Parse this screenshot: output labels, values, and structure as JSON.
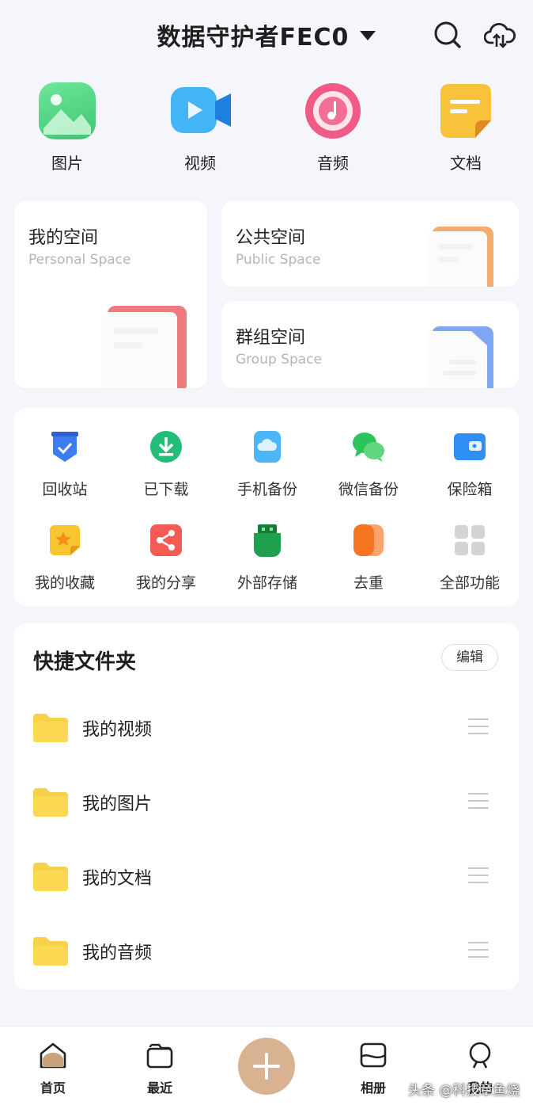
{
  "header": {
    "title": "数据守护者FEC0",
    "icons": [
      "search-icon",
      "cloud-transfer-icon"
    ]
  },
  "categories": [
    {
      "label": "图片",
      "icon": "image-icon",
      "color": "#4cd17a"
    },
    {
      "label": "视频",
      "icon": "video-icon",
      "color": "#3aa7f0"
    },
    {
      "label": "音频",
      "icon": "audio-icon",
      "color": "#f05f86"
    },
    {
      "label": "文档",
      "icon": "document-icon",
      "color": "#f7b526"
    }
  ],
  "spaces": {
    "personal": {
      "cn": "我的空间",
      "en": "Personal Space"
    },
    "public": {
      "cn": "公共空间",
      "en": "Public Space"
    },
    "group": {
      "cn": "群组空间",
      "en": "Group Space"
    }
  },
  "functions": [
    {
      "label": "回收站",
      "icon": "recycle-bin-icon",
      "color": "#3b73e8"
    },
    {
      "label": "已下载",
      "icon": "downloaded-icon",
      "color": "#29c07a"
    },
    {
      "label": "手机备份",
      "icon": "phone-backup-icon",
      "color": "#46b3f5"
    },
    {
      "label": "微信备份",
      "icon": "wechat-backup-icon",
      "color": "#2cc35b"
    },
    {
      "label": "保险箱",
      "icon": "safe-box-icon",
      "color": "#2e8ef0"
    },
    {
      "label": "我的收藏",
      "icon": "favorites-icon",
      "color": "#f6c12a"
    },
    {
      "label": "我的分享",
      "icon": "share-icon",
      "color": "#f45d55"
    },
    {
      "label": "外部存储",
      "icon": "external-storage-icon",
      "color": "#1f9c4b"
    },
    {
      "label": "去重",
      "icon": "dedupe-icon",
      "color": "#f57a25"
    },
    {
      "label": "全部功能",
      "icon": "all-functions-icon",
      "color": "#d7d7d7"
    }
  ],
  "quick_folders": {
    "title": "快捷文件夹",
    "edit_label": "编辑",
    "items": [
      {
        "name": "我的视频"
      },
      {
        "name": "我的图片"
      },
      {
        "name": "我的文档"
      },
      {
        "name": "我的音频"
      }
    ]
  },
  "bottom_nav": [
    {
      "label": "首页",
      "icon": "home-icon"
    },
    {
      "label": "最近",
      "icon": "recent-icon"
    },
    {
      "label": "相册",
      "icon": "album-icon"
    },
    {
      "label": "我的",
      "icon": "profile-icon"
    }
  ],
  "fab": {
    "icon": "plus-icon",
    "color": "#d9b292"
  },
  "watermark": "头条 @科技章鱼烧"
}
